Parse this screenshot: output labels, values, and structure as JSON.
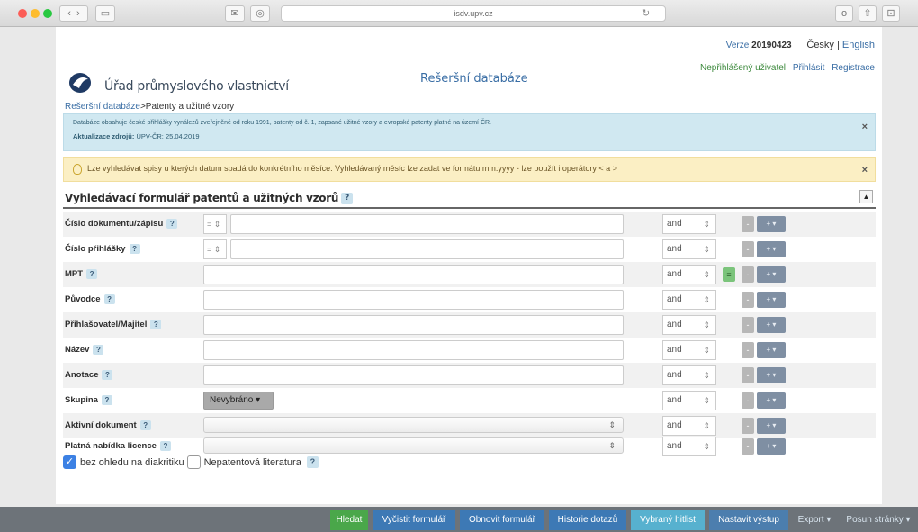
{
  "browser": {
    "url": "isdv.upv.cz",
    "reload": "↻",
    "right_icons": [
      "o",
      "⇧",
      "⊡"
    ]
  },
  "header": {
    "version_label": "Verze",
    "version": "20190423",
    "lang_cz": "Česky",
    "lang_sep": " | ",
    "lang_en": "English",
    "office_name": "Úřad průmyslového vlastnictví",
    "db_title": "Rešeršní databáze",
    "user_status": "Nepřihlášený uživatel",
    "login": "Přihlásit",
    "register": "Registrace"
  },
  "breadcrumb": {
    "link": "Rešeršní databáze",
    "sep": ">",
    "current": "Patenty a užitné vzory"
  },
  "info_alert": {
    "line1": "Databáze obsahuje české přihlášky vynálezů zveřejněné od roku 1991, patenty od č. 1, zapsané užitné vzory a evropské patenty platné na území ČR.",
    "update_label": "Aktualizace zdrojů:",
    "update_value": "ÚPV-ČR: 25.04.2019",
    "close": "×"
  },
  "warn_alert": {
    "text": "Lze vyhledávat spisy u kterých datum spadá do konkrétního měsíce. Vyhledávaný měsíc lze zadat ve formátu mm.yyyy - lze použít i operátory < a >",
    "close": "×"
  },
  "form": {
    "title": "Vyhledávací formulář patentů a užitných vzorů",
    "help": "?",
    "collapse": "▲",
    "op_symbol": "= ⇕",
    "and_label": "and",
    "and_arrow": "⇕",
    "eq_label": "=",
    "minus_label": "-",
    "plus_label": "+ ▾",
    "select_arrow": "⇕",
    "rows": [
      {
        "label": "Číslo dokumentu/zápisu"
      },
      {
        "label": "Číslo přihlášky"
      },
      {
        "label": "MPT"
      },
      {
        "label": "Původce"
      },
      {
        "label": "Přihlašovatel/Majitel"
      },
      {
        "label": "Název"
      },
      {
        "label": "Anotace"
      },
      {
        "label": "Skupina",
        "dropdown": "Nevybráno ▾"
      },
      {
        "label": "Aktivní dokument"
      },
      {
        "label": "Platná nabídka licence"
      }
    ],
    "check_diacritics": "bez ohledu na diakritiku",
    "check_nonpatent": "Nepatentová literatura",
    "check_mark": "✓"
  },
  "actions": {
    "search": "Hledat",
    "clear": "Vyčistit formulář",
    "restore": "Obnovit formulář",
    "history": "Historie dotazů",
    "hitlist": "Vybraný hitlist",
    "output": "Nastavit výstup",
    "export": "Export ▾",
    "page_shift": "Posun stránky ▾"
  }
}
